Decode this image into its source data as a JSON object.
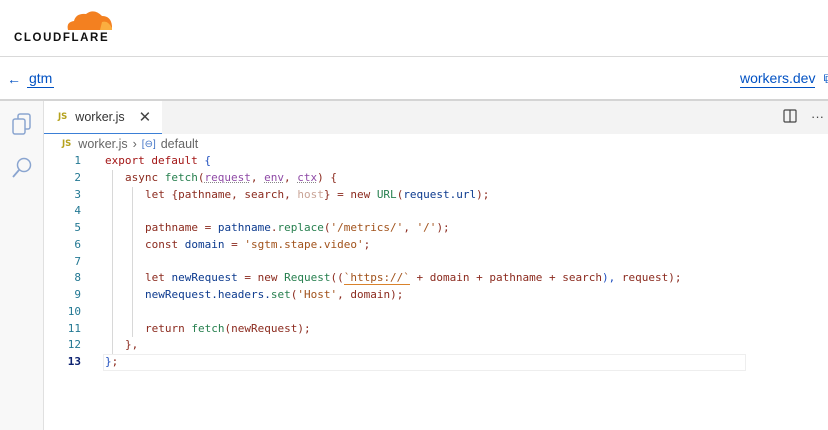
{
  "brand": {
    "name": "CLOUDFLARE"
  },
  "nav": {
    "back_label": "gtm",
    "workers_link": "workers.dev"
  },
  "tab": {
    "lang_badge": "JS",
    "filename": "worker.js"
  },
  "breadcrumb": {
    "lang_badge": "JS",
    "file": "worker.js",
    "symbol": "default"
  },
  "editor": {
    "current_line": 13,
    "lines": [
      {
        "n": "1",
        "indent": 0,
        "tokens": [
          [
            "k",
            "export default "
          ],
          [
            "b",
            "{"
          ]
        ]
      },
      {
        "n": "2",
        "indent": 1,
        "tokens": [
          [
            "t",
            "async "
          ],
          [
            "f",
            "fetch"
          ],
          [
            "t",
            "("
          ],
          [
            "p sq",
            "request"
          ],
          [
            "t",
            ", "
          ],
          [
            "p sq",
            "env"
          ],
          [
            "t",
            ", "
          ],
          [
            "p sq",
            "ctx"
          ],
          [
            "t",
            ") {"
          ]
        ]
      },
      {
        "n": "3",
        "indent": 2,
        "tokens": [
          [
            "t",
            "let {pathname, search, "
          ],
          [
            "d",
            "host"
          ],
          [
            "t",
            "} = new "
          ],
          [
            "f",
            "URL"
          ],
          [
            "t",
            "("
          ],
          [
            "v",
            "request.url"
          ],
          [
            "t",
            ");"
          ]
        ]
      },
      {
        "n": "4",
        "indent": 2,
        "tokens": []
      },
      {
        "n": "5",
        "indent": 2,
        "tokens": [
          [
            "t",
            "pathname = "
          ],
          [
            "v",
            "pathname"
          ],
          [
            "t",
            "."
          ],
          [
            "f",
            "replace"
          ],
          [
            "t",
            "("
          ],
          [
            "s",
            "'/metrics/'"
          ],
          [
            "t",
            ", "
          ],
          [
            "s",
            "'/'"
          ],
          [
            "t",
            ");"
          ]
        ]
      },
      {
        "n": "6",
        "indent": 2,
        "tokens": [
          [
            "t",
            "const "
          ],
          [
            "v",
            "domain"
          ],
          [
            "t",
            " = "
          ],
          [
            "s",
            "'sgtm.stape.video'"
          ],
          [
            "t",
            ";"
          ]
        ]
      },
      {
        "n": "7",
        "indent": 2,
        "tokens": []
      },
      {
        "n": "8",
        "indent": 2,
        "tokens": [
          [
            "t",
            "let "
          ],
          [
            "v",
            "newRequest"
          ],
          [
            "t",
            " = new "
          ],
          [
            "f",
            "Request"
          ],
          [
            "t",
            "(("
          ],
          [
            "s ul",
            "`https://`"
          ],
          [
            "t",
            " + domain + pathname + search"
          ],
          [
            "b",
            "), "
          ],
          [
            "t",
            "request);"
          ]
        ]
      },
      {
        "n": "9",
        "indent": 2,
        "tokens": [
          [
            "v",
            "newRequest.headers."
          ],
          [
            "f",
            "set"
          ],
          [
            "t",
            "("
          ],
          [
            "s",
            "'Host'"
          ],
          [
            "t",
            ", domain);"
          ]
        ]
      },
      {
        "n": "10",
        "indent": 2,
        "tokens": []
      },
      {
        "n": "11",
        "indent": 2,
        "tokens": [
          [
            "t",
            "return "
          ],
          [
            "f",
            "fetch"
          ],
          [
            "t",
            "(newRequest);"
          ]
        ]
      },
      {
        "n": "12",
        "indent": 1,
        "tokens": [
          [
            "t",
            "},"
          ]
        ]
      },
      {
        "n": "13",
        "indent": 0,
        "tokens": [
          [
            "b",
            "}"
          ],
          [
            "t",
            ";"
          ]
        ]
      }
    ]
  },
  "colors": {
    "accent": "#0051c3",
    "brand_orange": "#f38020"
  }
}
